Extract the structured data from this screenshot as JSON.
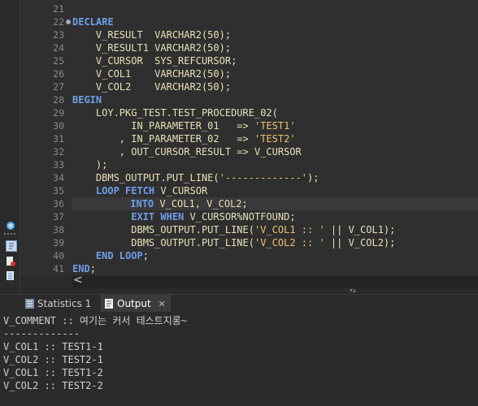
{
  "editor": {
    "lines": [
      {
        "n": "21",
        "segs": []
      },
      {
        "n": "22",
        "fold": true,
        "segs": [
          {
            "t": "DECLARE",
            "c": "kw"
          }
        ]
      },
      {
        "n": "23",
        "segs": [
          {
            "t": "    V_RESULT  VARCHAR2(50);",
            "c": "id"
          }
        ]
      },
      {
        "n": "24",
        "segs": [
          {
            "t": "    V_RESULT1 VARCHAR2(50);",
            "c": "id"
          }
        ]
      },
      {
        "n": "25",
        "segs": [
          {
            "t": "    V_CURSOR  SYS_REFCURSOR;",
            "c": "id"
          }
        ]
      },
      {
        "n": "26",
        "segs": [
          {
            "t": "    V_COL1    VARCHAR2(50);",
            "c": "id"
          }
        ]
      },
      {
        "n": "27",
        "segs": [
          {
            "t": "    V_COL2    VARCHAR2(50);",
            "c": "id"
          }
        ]
      },
      {
        "n": "28",
        "segs": [
          {
            "t": "BEGIN",
            "c": "kw"
          }
        ]
      },
      {
        "n": "29",
        "segs": [
          {
            "t": "    LOY.PKG_TEST.TEST_PROCEDURE_02(",
            "c": "id"
          }
        ]
      },
      {
        "n": "30",
        "segs": [
          {
            "t": "          IN_PARAMETER_01   => ",
            "c": "id"
          },
          {
            "t": "'TEST1'",
            "c": "str"
          }
        ]
      },
      {
        "n": "31",
        "segs": [
          {
            "t": "        , IN_PARAMETER_02   => ",
            "c": "id"
          },
          {
            "t": "'TEST2'",
            "c": "str"
          }
        ]
      },
      {
        "n": "32",
        "segs": [
          {
            "t": "        , OUT_CURSOR_RESULT => V_CURSOR",
            "c": "id"
          }
        ]
      },
      {
        "n": "33",
        "segs": [
          {
            "t": "    );",
            "c": "id"
          }
        ]
      },
      {
        "n": "34",
        "segs": [
          {
            "t": "    DBMS_OUTPUT.PUT_LINE(",
            "c": "id"
          },
          {
            "t": "'-------------'",
            "c": "str"
          },
          {
            "t": ");",
            "c": "id"
          }
        ]
      },
      {
        "n": "35",
        "segs": [
          {
            "t": "    ",
            "c": "id"
          },
          {
            "t": "LOOP FETCH",
            "c": "kw"
          },
          {
            "t": " V_CURSOR",
            "c": "id"
          }
        ]
      },
      {
        "n": "36",
        "hl": true,
        "segs": [
          {
            "t": "          ",
            "c": "id"
          },
          {
            "t": "INTO",
            "c": "kw"
          },
          {
            "t": " V_COL1, V_COL2;",
            "c": "id"
          }
        ]
      },
      {
        "n": "37",
        "segs": [
          {
            "t": "          ",
            "c": "id"
          },
          {
            "t": "EXIT WHEN",
            "c": "kw"
          },
          {
            "t": " V_CURSOR%NOTFOUND;",
            "c": "id"
          }
        ]
      },
      {
        "n": "38",
        "segs": [
          {
            "t": "          DBMS_OUTPUT.PUT_LINE(",
            "c": "id"
          },
          {
            "t": "'V_COL1 :: '",
            "c": "str"
          },
          {
            "t": " || V_COL1);",
            "c": "id"
          }
        ]
      },
      {
        "n": "39",
        "segs": [
          {
            "t": "          DBMS_OUTPUT.PUT_LINE(",
            "c": "id"
          },
          {
            "t": "'V_COL2 :: '",
            "c": "str"
          },
          {
            "t": " || V_COL2);",
            "c": "id"
          }
        ]
      },
      {
        "n": "40",
        "segs": [
          {
            "t": "    ",
            "c": "id"
          },
          {
            "t": "END LOOP",
            "c": "kw"
          },
          {
            "t": ";",
            "c": "id"
          }
        ]
      },
      {
        "n": "41",
        "segs": [
          {
            "t": "END",
            "c": "kw"
          },
          {
            "t": ";",
            "c": "id"
          }
        ]
      }
    ],
    "colors": {
      "keyword": "#6f9ee8",
      "string": "#f0c36a",
      "identifier": "#e9e0b8"
    }
  },
  "hscroll": {
    "arrow": "<"
  },
  "tabs": {
    "statistics": {
      "label": "Statistics 1",
      "icon": "statistics-icon"
    },
    "output": {
      "label": "Output",
      "icon": "output-icon",
      "close": "✕"
    }
  },
  "output_lines": [
    "V_COMMENT :: 여기는 커서 테스트지롱~",
    "-------------",
    "V_COL1 :: TEST1-1",
    "V_COL2 :: TEST2-1",
    "V_COL1 :: TEST1-2",
    "V_COL2 :: TEST2-2"
  ]
}
